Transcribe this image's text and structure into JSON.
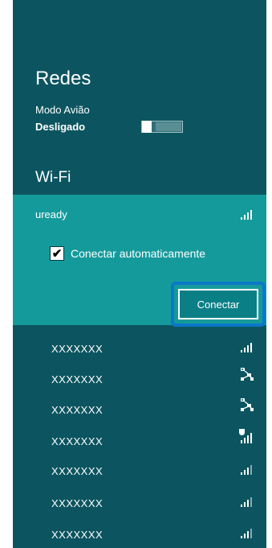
{
  "panel": {
    "title": "Redes",
    "airplane": {
      "label": "Modo Avião",
      "state": "Desligado"
    },
    "wifi_title": "Wi-Fi",
    "selected_network": {
      "name": "uready",
      "auto_connect_label": "Conectar automaticamente",
      "auto_connect_checked": true,
      "connect_button": "Conectar"
    },
    "networks": [
      {
        "name": "XXXXXXX",
        "icon": "wifi-signal-icon"
      },
      {
        "name": "XXXXXXX",
        "icon": "wired-network-icon"
      },
      {
        "name": "XXXXXXX",
        "icon": "wired-network-icon"
      },
      {
        "name": "XXXXXXX",
        "icon": "wifi-secured-signal-icon"
      },
      {
        "name": "XXXXXXX",
        "icon": "wifi-signal-icon"
      },
      {
        "name": "XXXXXXX",
        "icon": "wifi-signal-icon"
      },
      {
        "name": "XXXXXXX",
        "icon": "wifi-signal-icon"
      }
    ]
  },
  "colors": {
    "panel_bg": "#0c5560",
    "selected_bg": "#159a9c",
    "focus_border": "#0a78c8"
  }
}
